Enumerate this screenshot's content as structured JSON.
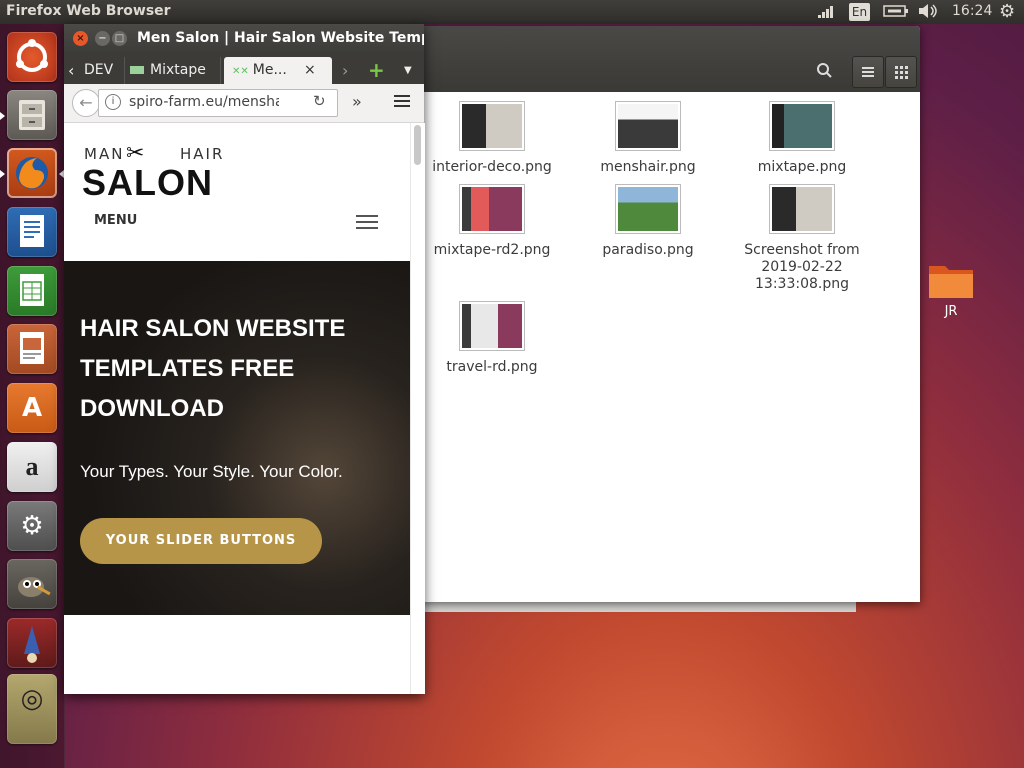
{
  "top_panel": {
    "title": "Firefox Web Browser",
    "keyboard": "En",
    "clock": "16:24"
  },
  "launcher": {
    "items": [
      {
        "name": "ubuntu-dash"
      },
      {
        "name": "files"
      },
      {
        "name": "firefox"
      },
      {
        "name": "writer"
      },
      {
        "name": "calc"
      },
      {
        "name": "impress"
      },
      {
        "name": "software-center"
      },
      {
        "name": "amazon"
      },
      {
        "name": "system-settings"
      },
      {
        "name": "gimp"
      },
      {
        "name": "app-11"
      }
    ]
  },
  "files_window": {
    "files": [
      {
        "name": "interior-deco.png",
        "thumb": "dark"
      },
      {
        "name": "menshair.png",
        "thumb": "web"
      },
      {
        "name": "mixtape.png",
        "thumb": "dark"
      },
      {
        "name": "mixtape-rd2.png",
        "thumb": "purple"
      },
      {
        "name": "paradiso.png",
        "thumb": "green"
      },
      {
        "name": "Screenshot from 2019-02-22 13:33:08.png",
        "thumb": "dark"
      },
      {
        "name": "travel-rd.png",
        "thumb": "purple"
      }
    ]
  },
  "desktop": {
    "folder_label": "JR"
  },
  "firefox": {
    "window_title": "Men Salon | Hair Salon Website Templa",
    "tabs": [
      {
        "label": "DEV"
      },
      {
        "label": "Mixtape"
      },
      {
        "label": "Me..."
      }
    ],
    "url": "spiro-farm.eu/mensha",
    "page": {
      "logo_top_left": "MAN",
      "logo_top_right": "HAIR",
      "logo_main": "SALON",
      "menu_label": "MENU",
      "hero_title_line1": "HAIR SALON WEBSITE",
      "hero_title_line2": "TEMPLATES FREE",
      "hero_title_line3": "DOWNLOAD",
      "hero_subtitle": "Your Types. Your Style. Your Color.",
      "hero_button": "YOUR SLIDER BUTTONS"
    }
  },
  "colors": {
    "accent_gold": "#b69549",
    "firefox_orange": "#e66000"
  }
}
